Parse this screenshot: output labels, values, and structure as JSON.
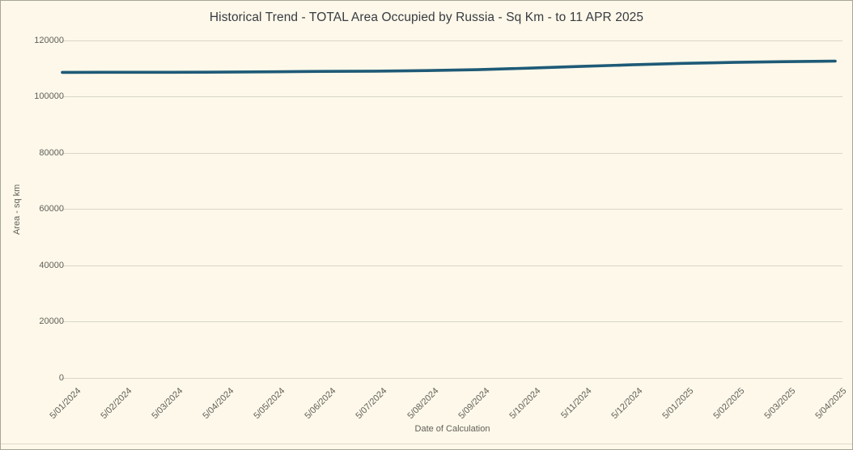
{
  "chart": {
    "title": "Historical Trend - TOTAL Area Occupied by Russia - Sq Km - to 11 APR 2025",
    "x_axis_title": "Date of Calculation",
    "y_axis_title": "Area - sq km"
  },
  "chart_data": {
    "type": "line",
    "title": "Historical Trend - TOTAL Area Occupied by Russia - Sq Km - to 11 APR 2025",
    "xlabel": "Date of Calculation",
    "ylabel": "Area - sq km",
    "x_labels": [
      "5/01/2024",
      "5/02/2024",
      "5/03/2024",
      "5/04/2024",
      "5/05/2024",
      "5/06/2024",
      "5/07/2024",
      "5/08/2024",
      "5/09/2024",
      "5/10/2024",
      "5/11/2024",
      "5/12/2024",
      "5/01/2025",
      "5/02/2025",
      "5/03/2025",
      "5/04/2025"
    ],
    "series": [
      {
        "name": "TOTAL Area Occupied by Russia - Sq Km",
        "values": [
          108650,
          108700,
          108700,
          108750,
          108850,
          109000,
          109100,
          109300,
          109600,
          110150,
          110750,
          111350,
          111850,
          112200,
          112450,
          112650
        ]
      }
    ],
    "ylim": [
      0,
      120000
    ],
    "y_ticks": [
      0,
      20000,
      40000,
      60000,
      80000,
      100000,
      120000
    ],
    "grid": "horizontal",
    "legend": "none"
  },
  "colors": {
    "background": "#fdf8e9",
    "line": "#1e5a77",
    "gridline": "#d9d5c9",
    "title_text": "#383b42",
    "label_text": "#615f58",
    "border": "#a8a49b"
  }
}
